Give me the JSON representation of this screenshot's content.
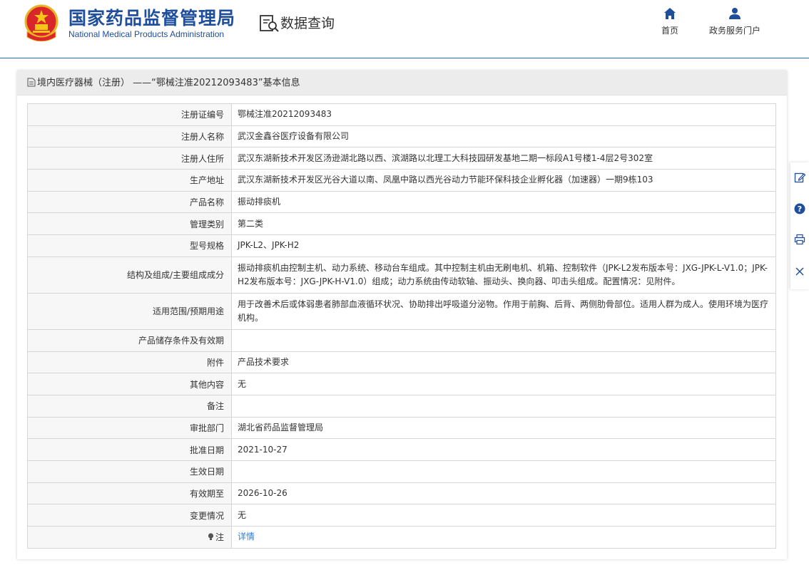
{
  "header": {
    "brand_cn": "国家药品监督管理局",
    "brand_en": "National Medical Products Administration",
    "query_title": "数据查询",
    "nav": {
      "home_label": "首页",
      "portal_label": "政务服务门户"
    }
  },
  "panel": {
    "title": "境内医疗器械（注册） ——“鄂械注准20212093483”基本信息"
  },
  "rows": [
    {
      "label": "注册证编号",
      "value": "鄂械注准20212093483"
    },
    {
      "label": "注册人名称",
      "value": "武汉金鑫谷医疗设备有限公司"
    },
    {
      "label": "注册人住所",
      "value": "武汉东湖新技术开发区汤逊湖北路以西、滨湖路以北理工大科技园研发基地二期一标段A1号楼1-4层2号302室"
    },
    {
      "label": "生产地址",
      "value": "武汉东湖新技术开发区光谷大道以南、凤凰中路以西光谷动力节能环保科技企业孵化器（加速器）一期9栋103"
    },
    {
      "label": "产品名称",
      "value": "振动排痰机"
    },
    {
      "label": "管理类别",
      "value": "第二类"
    },
    {
      "label": "型号规格",
      "value": "JPK-L2、JPK-H2"
    },
    {
      "label": "结构及组成/主要组成成分",
      "value": "振动排痰机由控制主机、动力系统、移动台车组成。其中控制主机由无刷电机、机箱、控制软件（JPK-L2发布版本号：JXG-JPK-L-V1.0；JPK-H2发布版本号：JXG-JPK-H-V1.0）组成；动力系统由传动软轴、振动头、换向器、叩击头组成。配置情况：见附件。"
    },
    {
      "label": "适用范围/预期用途",
      "value": "用于改善术后或体弱患者肺部血液循环状况、协助排出呼吸道分泌物。作用于前胸、后背、两侧肋骨部位。适用人群为成人。使用环境为医疗机构。"
    },
    {
      "label": "产品储存条件及有效期",
      "value": ""
    },
    {
      "label": "附件",
      "value": "产品技术要求"
    },
    {
      "label": "其他内容",
      "value": "无"
    },
    {
      "label": "备注",
      "value": ""
    },
    {
      "label": "审批部门",
      "value": "湖北省药品监督管理局"
    },
    {
      "label": "批准日期",
      "value": "2021-10-27"
    },
    {
      "label": "生效日期",
      "value": ""
    },
    {
      "label": "有效期至",
      "value": "2026-10-26"
    },
    {
      "label": "变更情况",
      "value": "无"
    },
    {
      "label": "注",
      "value": "详情"
    }
  ],
  "colors": {
    "brand_blue": "#1e4e9c",
    "header_border": "#1d6fb8",
    "link_blue": "#2b7fd4",
    "panel_head_bg": "#ececec"
  },
  "icons": {
    "emblem": "national-emblem-icon",
    "query": "search-document-icon",
    "home": "home-icon",
    "portal": "user-icon",
    "note": "lightbulb-icon",
    "side": [
      "edit-icon",
      "help-icon",
      "print-icon",
      "close-icon"
    ]
  }
}
